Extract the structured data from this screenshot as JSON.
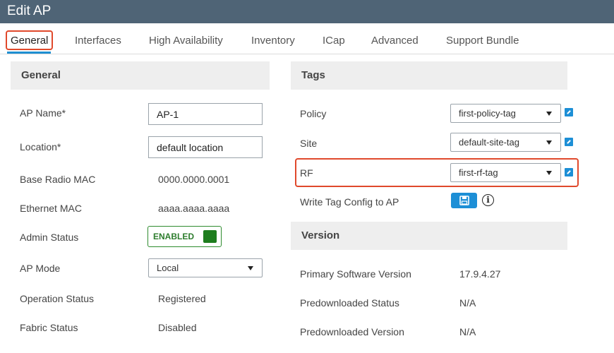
{
  "window": {
    "title": "Edit AP"
  },
  "tabs": [
    {
      "label": "General",
      "active": true
    },
    {
      "label": "Interfaces"
    },
    {
      "label": "High Availability"
    },
    {
      "label": "Inventory"
    },
    {
      "label": "ICap"
    },
    {
      "label": "Advanced"
    },
    {
      "label": "Support Bundle"
    }
  ],
  "general": {
    "heading": "General",
    "ap_name": {
      "label": "AP Name*",
      "value": "AP-1"
    },
    "location": {
      "label": "Location*",
      "value": "default location"
    },
    "base_radio_mac": {
      "label": "Base Radio MAC",
      "value": "0000.0000.0001"
    },
    "ethernet_mac": {
      "label": "Ethernet MAC",
      "value": "aaaa.aaaa.aaaa"
    },
    "admin_status": {
      "label": "Admin Status",
      "value": "ENABLED"
    },
    "ap_mode": {
      "label": "AP Mode",
      "value": "Local"
    },
    "operation_status": {
      "label": "Operation Status",
      "value": "Registered"
    },
    "fabric_status": {
      "label": "Fabric Status",
      "value": "Disabled"
    }
  },
  "tags": {
    "heading": "Tags",
    "policy": {
      "label": "Policy",
      "value": "first-policy-tag"
    },
    "site": {
      "label": "Site",
      "value": "default-site-tag"
    },
    "rf": {
      "label": "RF",
      "value": "first-rf-tag"
    },
    "write_tag": {
      "label": "Write Tag Config to AP"
    }
  },
  "version": {
    "heading": "Version",
    "primary_sw": {
      "label": "Primary Software Version",
      "value": "17.9.4.27"
    },
    "predownloaded_status": {
      "label": "Predownloaded Status",
      "value": "N/A"
    },
    "predownloaded_version": {
      "label": "Predownloaded Version",
      "value": "N/A"
    }
  },
  "colors": {
    "titlebar": "#4f6476",
    "accent": "#1d8fd6",
    "highlight": "#e0492c",
    "enabled_green": "#1e7d1e"
  },
  "icons": {
    "edit": "external-edit-icon",
    "save": "save-floppy-icon",
    "info": "info-circle-icon",
    "dropdown": "chevron-down-icon"
  }
}
